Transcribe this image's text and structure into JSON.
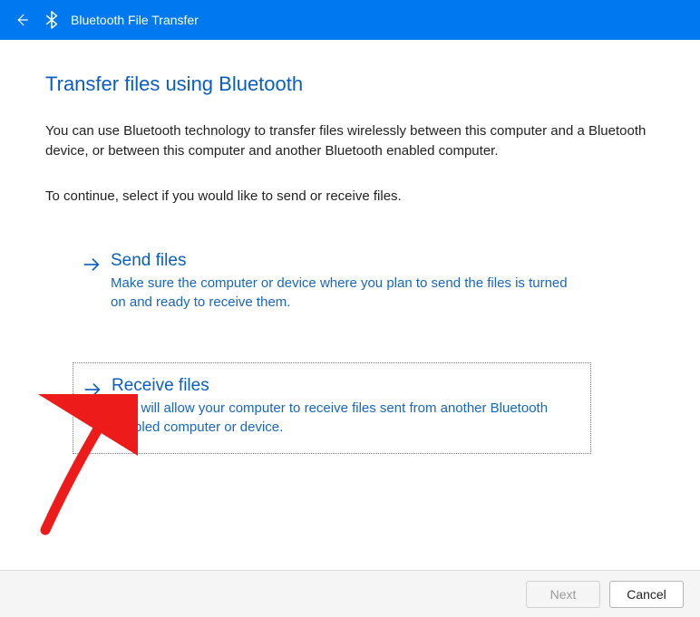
{
  "titlebar": {
    "title": "Bluetooth File Transfer"
  },
  "page": {
    "heading": "Transfer files using Bluetooth",
    "intro": "You can use Bluetooth technology to transfer files wirelessly between this computer and a Bluetooth device, or between this computer and another Bluetooth enabled computer.",
    "instruction": "To continue, select if you would like to send or receive files."
  },
  "options": {
    "send": {
      "title": "Send files",
      "desc": "Make sure the computer or device where you plan to send the files is turned on and ready to receive them."
    },
    "receive": {
      "title": "Receive files",
      "desc": "This will allow your computer to receive files sent from another Bluetooth enabled computer or device."
    }
  },
  "footer": {
    "next": "Next",
    "cancel": "Cancel"
  },
  "colors": {
    "accent": "#0078ef",
    "link": "#0a5ec2"
  }
}
